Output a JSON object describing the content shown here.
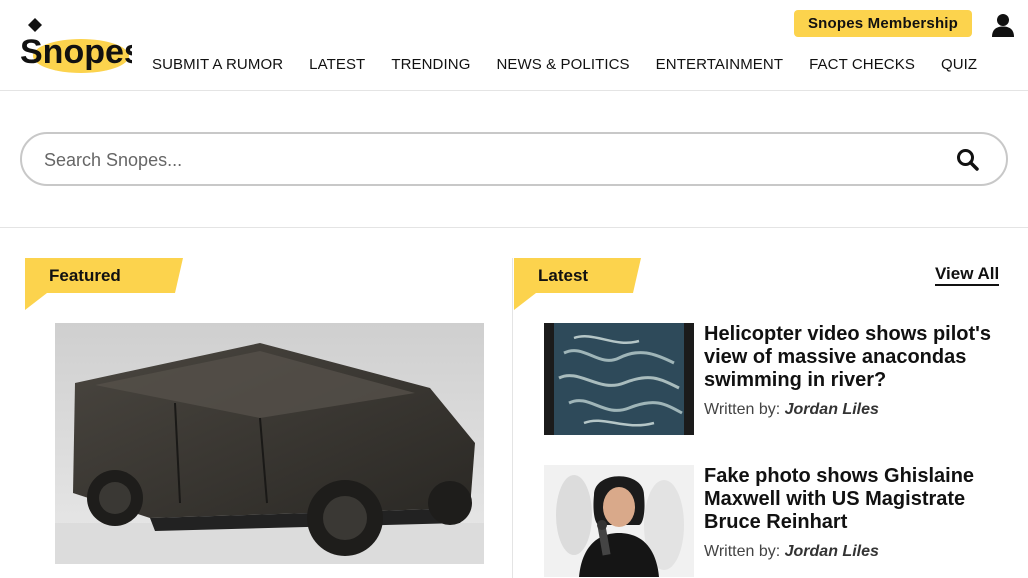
{
  "header": {
    "logo_text": "Snopes",
    "nav": [
      "SUBMIT A RUMOR",
      "LATEST",
      "TRENDING",
      "NEWS & POLITICS",
      "ENTERTAINMENT",
      "FACT CHECKS",
      "QUIZ"
    ],
    "membership_label": "Snopes Membership",
    "user_icon": "user-icon"
  },
  "search": {
    "placeholder": "Search Snopes...",
    "value": "",
    "icon": "search-icon"
  },
  "featured": {
    "label": "Featured",
    "image_icon": "vehicle-photo"
  },
  "latest": {
    "label": "Latest",
    "view_all": "View All",
    "articles": [
      {
        "title": "Helicopter video shows pilot's view of massive anacondas swimming in river?",
        "byline_prefix": "Written by:",
        "author": "Jordan Liles"
      },
      {
        "title": "Fake photo shows Ghislaine Maxwell with US Magistrate Bruce Reinhart",
        "byline_prefix": "Written by:",
        "author": "Jordan Liles"
      }
    ]
  },
  "colors": {
    "accent": "#fcd34d",
    "text": "#111111",
    "border": "#e4e4e4"
  }
}
